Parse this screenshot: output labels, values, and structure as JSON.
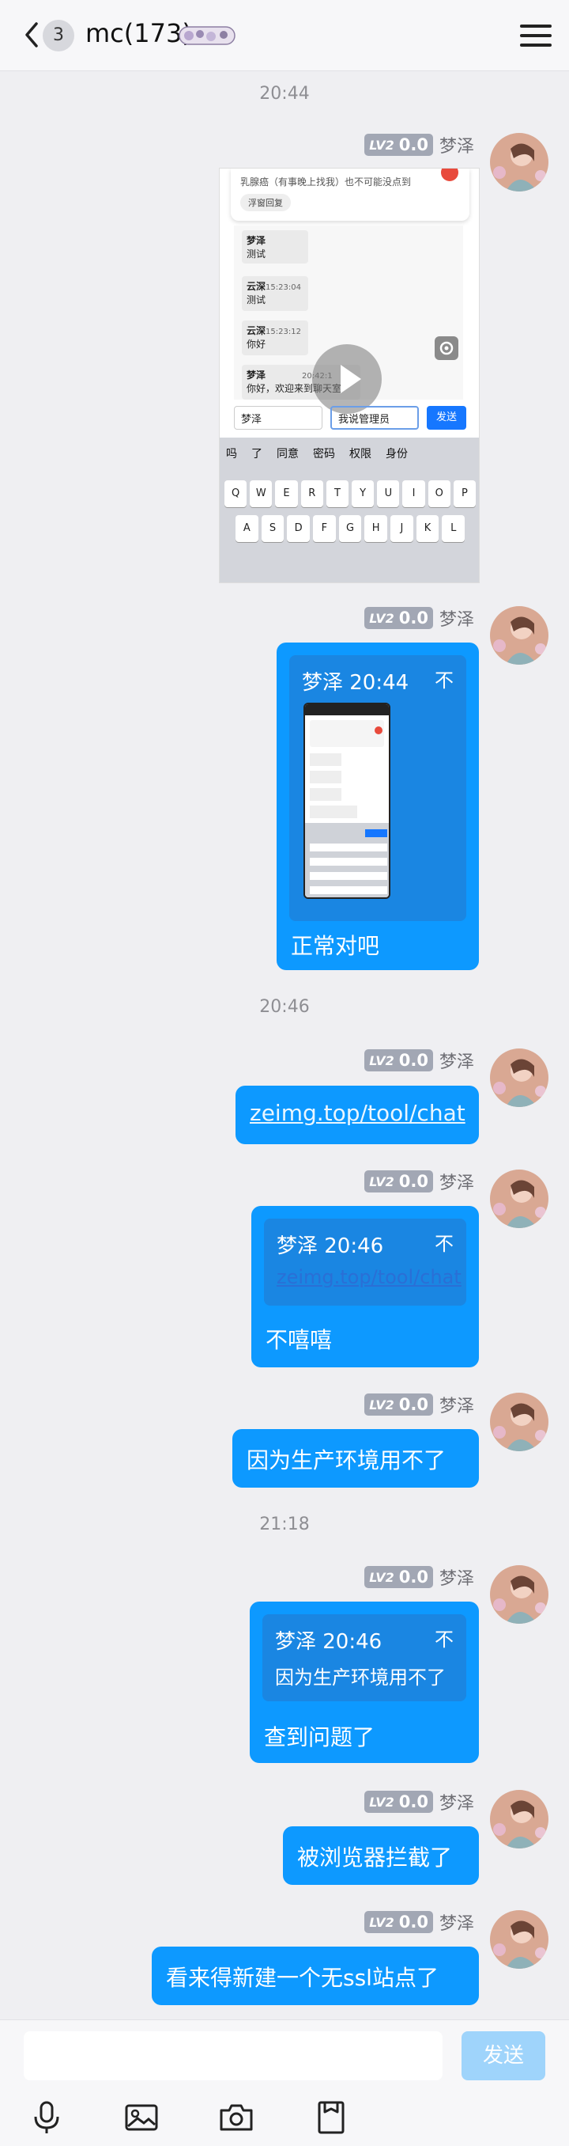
{
  "header": {
    "unread_count": "3",
    "title": "mc(173)"
  },
  "times": [
    "20:44",
    "20:46",
    "21:18"
  ],
  "level": {
    "tag": "LV2",
    "value": "0.0"
  },
  "sender": "梦泽",
  "screenshot": {
    "notice_line": "乳腺癌（有事晚上找我）也不可能没点到",
    "float_button": "浮窗回复",
    "messages": [
      {
        "name": "梦泽",
        "text": "测试"
      },
      {
        "name": "云深",
        "time": "15:23:04",
        "text": "测试"
      },
      {
        "name": "云深",
        "time": "15:23:12",
        "text": "你好"
      },
      {
        "name": "梦泽",
        "time": "20:42:1",
        "text": "你好，欢迎来到聊天室"
      }
    ],
    "name_input": "梦泽",
    "msg_input": "我说管理员",
    "send": "发送",
    "suggestions": [
      "吗",
      "了",
      "同意",
      "密码",
      "权限",
      "身份"
    ],
    "row1": [
      "Q",
      "W",
      "E",
      "R",
      "T",
      "Y",
      "U",
      "I",
      "O",
      "P"
    ],
    "row2": [
      "A",
      "S",
      "D",
      "F",
      "G",
      "H",
      "J",
      "K",
      "L"
    ]
  },
  "messages": {
    "m2": {
      "quote_head": "梦泽 20:44",
      "pin": "不",
      "text": "正常对吧"
    },
    "m3": {
      "text": "zeimg.top/tool/chat"
    },
    "m4": {
      "quote_head": "梦泽 20:46",
      "pin": "不",
      "quote_text": "zeimg.top/tool/chat",
      "text": "不嘻嘻"
    },
    "m5": {
      "text": "因为生产环境用不了"
    },
    "m6": {
      "quote_head": "梦泽 20:46",
      "pin": "不",
      "quote_text": "因为生产环境用不了",
      "text": "查到问题了"
    },
    "m7": {
      "text": "被浏览器拦截了"
    },
    "m8": {
      "text": "看来得新建一个无ssl站点了"
    }
  },
  "input": {
    "placeholder": "",
    "send": "发送"
  },
  "colors": {
    "bubble": "#0d99ff",
    "send_disabled": "#9fd4fb"
  }
}
